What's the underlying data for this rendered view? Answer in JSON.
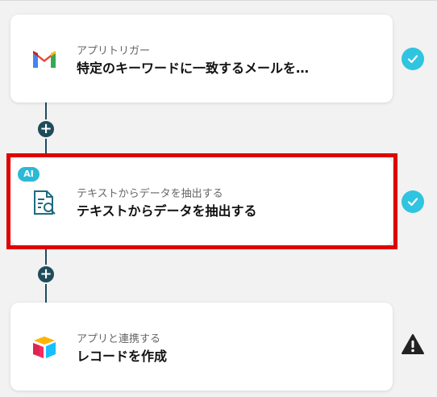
{
  "flow": {
    "steps": [
      {
        "subtitle": "アプリトリガー",
        "title": "特定のキーワードに一致するメールを…",
        "icon": "gmail-icon",
        "status": "completed"
      },
      {
        "badge": "AI",
        "subtitle": "テキストからデータを抽出する",
        "title": "テキストからデータを抽出する",
        "icon": "document-search-icon",
        "status": "completed",
        "highlighted": true
      },
      {
        "subtitle": "アプリと連携する",
        "title": "レコードを作成",
        "icon": "airtable-icon",
        "status": "warning"
      }
    ],
    "add_button_label": "+"
  },
  "colors": {
    "background": "#f2f2f2",
    "connector": "#1f4c5b",
    "check": "#2fc4df",
    "ai_badge": "#2ab9d6",
    "highlight": "#e00000",
    "warning": "#222222"
  }
}
